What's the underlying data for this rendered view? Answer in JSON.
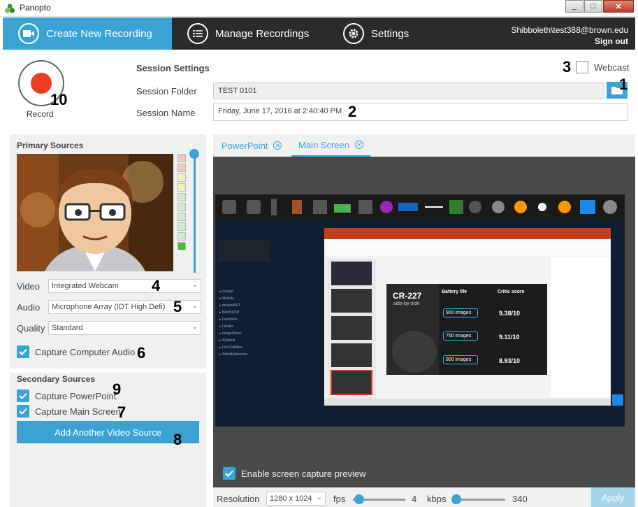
{
  "window": {
    "title": "Panopto",
    "min": "_",
    "max": "□",
    "close": "✕"
  },
  "nav": {
    "tabs": [
      {
        "label": "Create New Recording",
        "icon": "camera-icon"
      },
      {
        "label": "Manage Recordings",
        "icon": "list-icon"
      },
      {
        "label": "Settings",
        "icon": "gear-icon"
      }
    ],
    "user": "Shibboleth\\test388@brown.edu",
    "signout": "Sign out"
  },
  "record": {
    "label": "Record"
  },
  "session": {
    "title": "Session Settings",
    "folder_label": "Session Folder",
    "folder_value": "TEST 0101",
    "name_label": "Session Name",
    "name_value": "Friday, June 17, 2016 at 2:40:40 PM",
    "webcast_label": "Webcast",
    "webcast_checked": false
  },
  "primary": {
    "title": "Primary Sources",
    "video_label": "Video",
    "video_value": "Integrated Webcam",
    "audio_label": "Audio",
    "audio_value": "Microphone Array (IDT High Defi)",
    "quality_label": "Quality",
    "quality_value": "Standard",
    "capture_audio_label": "Capture Computer Audio",
    "capture_audio_checked": true,
    "audio_level_fraction": 0.08
  },
  "secondary": {
    "title": "Secondary Sources",
    "powerpoint_label": "Capture PowerPoint",
    "powerpoint_checked": true,
    "mainscreen_label": "Capture Main Screen",
    "mainscreen_checked": true,
    "add_button": "Add Another Video Source"
  },
  "preview": {
    "tabs": [
      {
        "label": "PowerPoint",
        "active": false
      },
      {
        "label": "Main Screen",
        "active": true
      }
    ],
    "enable_label": "Enable screen capture preview",
    "enable_checked": true,
    "slide_title": "CR-227",
    "slide_subtitle": "side-by-side",
    "battery_life": "Battery life",
    "critic_score": "Critic score",
    "images": [
      "900 images",
      "750 images",
      "800 images"
    ],
    "scores": [
      "9.38/10",
      "9.11/10",
      "8.93/10"
    ]
  },
  "bottom": {
    "resolution_label": "Resolution",
    "resolution_value": "1280 x 1024",
    "fps_label": "fps",
    "fps_value": "4",
    "kbps_label": "kbps",
    "kbps_value": "340",
    "apply": "Apply"
  },
  "annotations": [
    "1",
    "2",
    "3",
    "4",
    "5",
    "6",
    "7",
    "8",
    "9",
    "10"
  ],
  "colors": {
    "accent": "#3aa3d4",
    "nav_bg": "#2b2b2b",
    "record": "#f13a22"
  }
}
